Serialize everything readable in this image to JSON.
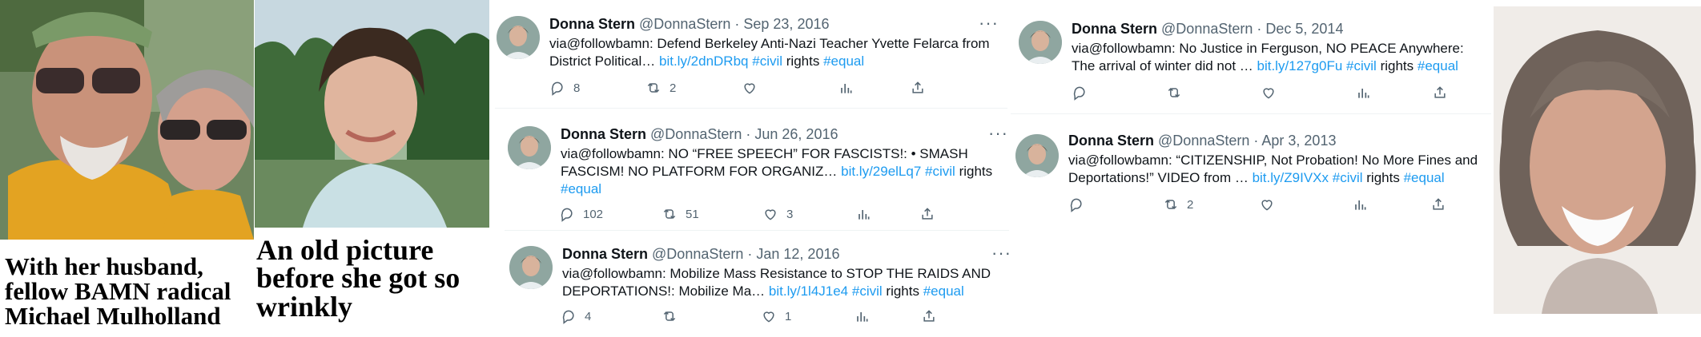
{
  "captions": {
    "left": [
      "With her husband,",
      "fellow BAMN radical",
      "Michael Mulholland"
    ],
    "middle": [
      "An old picture",
      "before she got so",
      "wrinkly"
    ]
  },
  "tweets": [
    {
      "name": "Donna Stern",
      "handle": "@DonnaStern",
      "date": "· Sep 23, 2016",
      "text": "via@followbamn: Defend Berkeley Anti-Nazi Teacher Yvette Felarca from District Political…",
      "link": "bit.ly/2dnDRbq",
      "tag1": "#civil",
      "rights": "rights",
      "tag2": "#equal",
      "replies": "8",
      "retweets": "2",
      "likes": ""
    },
    {
      "name": "Donna Stern",
      "handle": "@DonnaStern",
      "date": "· Jun 26, 2016",
      "text": "via@followbamn: NO “FREE SPEECH” FOR FASCISTS!: • SMASH FASCISM! NO PLATFORM FOR ORGANIZ…",
      "link": "bit.ly/29elLq7",
      "tag1": "#civil",
      "rights": "rights",
      "tag2": "#equal",
      "replies": "102",
      "retweets": "51",
      "likes": "3"
    },
    {
      "name": "Donna Stern",
      "handle": "@DonnaStern",
      "date": "· Jan 12, 2016",
      "text": "via@followbamn: Mobilize Mass Resistance to STOP THE RAIDS AND DEPORTATIONS!: Mobilize Ma…",
      "link": "bit.ly/1l4J1e4",
      "tag1": "#civil",
      "rights": "rights",
      "tag2": "#equal",
      "replies": "4",
      "retweets": "",
      "likes": "1"
    },
    {
      "name": "Donna Stern",
      "handle": "@DonnaStern",
      "date": "· Dec 5, 2014",
      "text": "via@followbamn: No Justice in Ferguson, NO PEACE Anywhere: The arrival of winter did not …",
      "link": "bit.ly/127g0Fu",
      "tag1": "#civil",
      "rights": "rights",
      "tag2": "#equal",
      "replies": "",
      "retweets": "",
      "likes": ""
    },
    {
      "name": "Donna Stern",
      "handle": "@DonnaStern",
      "date": "· Apr 3, 2013",
      "text": "via@followbamn: “CITIZENSHIP, Not Probation! No More Fines and Deportations!” VIDEO from …",
      "link": "bit.ly/Z9IVXx",
      "tag1": "#civil",
      "rights": "rights",
      "tag2": "#equal",
      "replies": "",
      "retweets": "2",
      "likes": ""
    }
  ],
  "more_glyph": "···",
  "icons": [
    "reply-icon",
    "retweet-icon",
    "like-icon",
    "views-icon",
    "share-icon",
    "more-icon"
  ],
  "colors": {
    "link": "#1d9bf0",
    "meta": "#536471",
    "text": "#0f1419"
  }
}
